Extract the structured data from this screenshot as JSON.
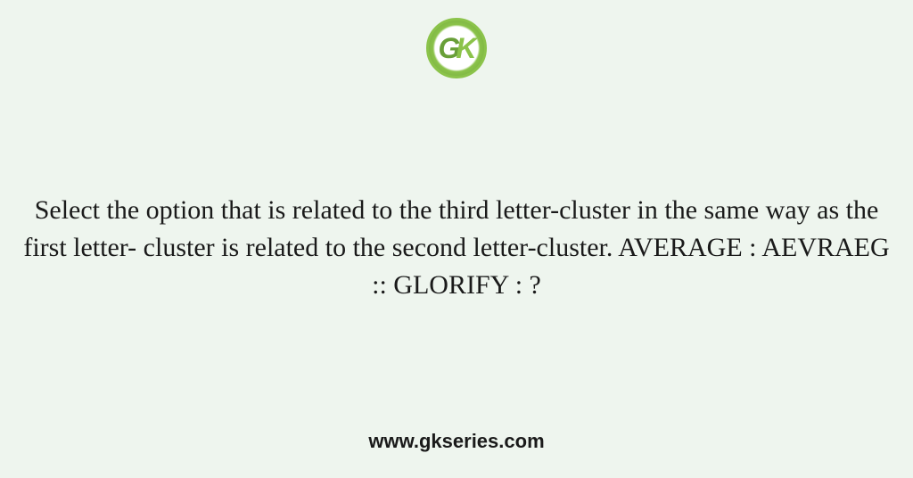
{
  "logo": {
    "letter_g": "G",
    "letter_k": "K"
  },
  "question": {
    "text": "Select the option that is related to the third letter-cluster in the same way as the first letter- cluster is related to the second letter-cluster. AVERAGE : AEVRAEG :: GLORIFY : ?"
  },
  "footer": {
    "url": "www.gkseries.com"
  }
}
